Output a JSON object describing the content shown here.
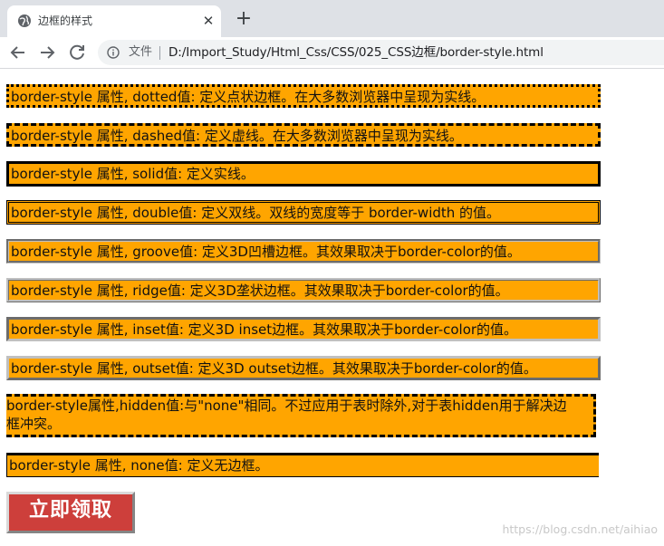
{
  "browser": {
    "tab_title": "边框的样式",
    "new_tab_symbol": "+",
    "close_symbol": "✕",
    "address": {
      "file_label": "文件",
      "url": "D:/Import_Study/Html_Css/CSS/025_CSS边框/border-style.html"
    }
  },
  "page": {
    "lines": {
      "dotted": "border-style 属性, dotted值: 定义点状边框。在大多数浏览器中呈现为实线。",
      "dashed": "border-style 属性, dashed值: 定义虚线。在大多数浏览器中呈现为实线。",
      "solid": "border-style 属性, solid值: 定义实线。",
      "double": "border-style 属性, double值: 定义双线。双线的宽度等于 border-width 的值。",
      "groove": "border-style 属性, groove值: 定义3D凹槽边框。其效果取决于border-color的值。",
      "ridge": "border-style 属性, ridge值: 定义3D垄状边框。其效果取决于border-color的值。",
      "inset": "border-style 属性, inset值: 定义3D inset边框。其效果取决于border-color的值。",
      "outset": "border-style 属性, outset值: 定义3D outset边框。其效果取决于border-color的值。",
      "hidden_1": "border-style属性,hidden值:与\"none\"相同。不过应用于表时除外,对于表hidden用于解决边",
      "hidden_2": "框冲突。",
      "none": "border-style 属性, none值: 定义无边框。"
    },
    "button_label": "立即领取",
    "watermark": "https://blog.csdn.net/aihiao"
  },
  "colors": {
    "box_background": "#ffa500",
    "button_background": "#cd3f3b",
    "tabstrip": "#dee1e6"
  },
  "icons": {
    "tab_favicon": "globe-icon",
    "back": "back-arrow-icon",
    "forward": "forward-arrow-icon",
    "reload": "reload-icon",
    "info": "info-icon"
  }
}
